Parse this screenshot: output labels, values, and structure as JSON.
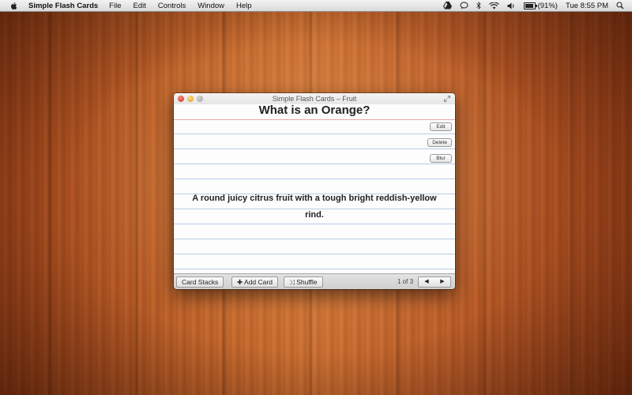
{
  "menubar": {
    "app_name": "Simple Flash Cards",
    "items": [
      "File",
      "Edit",
      "Controls",
      "Window",
      "Help"
    ],
    "battery": "(91%)",
    "battery_level": 0.91,
    "clock": "Tue 8:55 PM"
  },
  "window": {
    "title": "Simple Flash Cards – Fruit",
    "question": "What is an Orange?",
    "answer": "A round juicy citrus fruit with a tough bright reddish-yellow rind.",
    "side_buttons": {
      "edit": "Edit",
      "delete": "Delete",
      "blur": "Blur"
    },
    "toolbar": {
      "card_stacks": "Card Stacks",
      "add_card": "Add Card",
      "shuffle": "Shuffle",
      "counter": "1 of 3",
      "prev": "◀",
      "next": "▶"
    }
  }
}
